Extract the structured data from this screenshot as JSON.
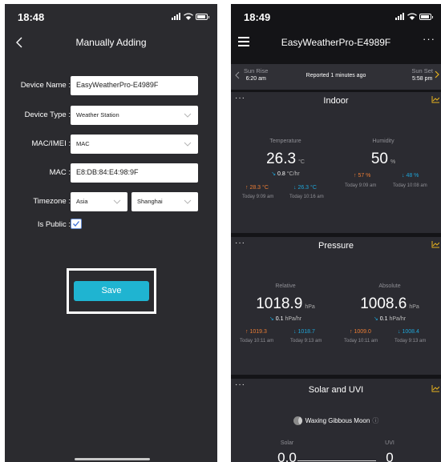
{
  "left": {
    "status": {
      "time": "18:48"
    },
    "nav": {
      "title": "Manually Adding"
    },
    "form": {
      "device_name": {
        "label": "Device Name :",
        "value": "EasyWeatherPro-E4989F"
      },
      "device_type": {
        "label": "Device Type :",
        "value": "Weather Station"
      },
      "mac_imei": {
        "label": "MAC/IMEI :",
        "value": "MAC"
      },
      "mac": {
        "label": "MAC :",
        "value": "E8:DB:84:E4:98:9F"
      },
      "timezone": {
        "label": "Timezone :",
        "region": "Asia",
        "city": "Shanghai"
      },
      "is_public": {
        "label": "Is Public :",
        "checked": true
      }
    },
    "save_label": "Save"
  },
  "right": {
    "status": {
      "time": "18:49"
    },
    "nav": {
      "title": "EasyWeatherPro-E4989F",
      "more": "···"
    },
    "sunbar": {
      "sunrise_label": "Sun Rise",
      "sunrise_time": "6:20 am",
      "reported": "Reported 1 minutes ago",
      "sunset_label": "Sun Set",
      "sunset_time": "5:58 pm"
    },
    "indoor": {
      "title": "Indoor",
      "temperature": {
        "label": "Temperature",
        "value": "26.3",
        "unit": "°C",
        "rate": "0.8",
        "rate_unit": "°C/hr",
        "high": "↑ 28.3 °C",
        "low": "↓ 26.3 °C",
        "high_time": "Today 9:09 am",
        "low_time": "Today 10:16 am"
      },
      "humidity": {
        "label": "Humidity",
        "value": "50",
        "unit": "%",
        "high": "↑ 57 %",
        "low": "↓ 48 %",
        "high_time": "Today 9:09 am",
        "low_time": "Today 10:08 am"
      }
    },
    "pressure": {
      "title": "Pressure",
      "relative": {
        "label": "Relative",
        "value": "1018.9",
        "unit": "hPa",
        "rate": "0.1",
        "rate_unit": "hPa/hr",
        "high": "↑ 1019.3",
        "low": "↓ 1018.7",
        "high_time": "Today 10:11 am",
        "low_time": "Today 9:13 am"
      },
      "absolute": {
        "label": "Absolute",
        "value": "1008.6",
        "unit": "hPa",
        "rate": "0.1",
        "rate_unit": "hPa/hr",
        "high": "↑ 1009.0",
        "low": "↓ 1008.4",
        "high_time": "Today 10:11 am",
        "low_time": "Today 9:13 am"
      }
    },
    "solar": {
      "title": "Solar and UVI",
      "moon": "Waxing Gibbous Moon",
      "solar_label": "Solar",
      "solar_value": "0.0",
      "uvi_label": "UVI",
      "uvi_value": "0"
    }
  },
  "colors": {
    "accent_blue": "#1fb4d1",
    "high_orange": "#ec7d35",
    "low_blue": "#1fa5d8",
    "graph_yellow": "#e6b21e"
  }
}
